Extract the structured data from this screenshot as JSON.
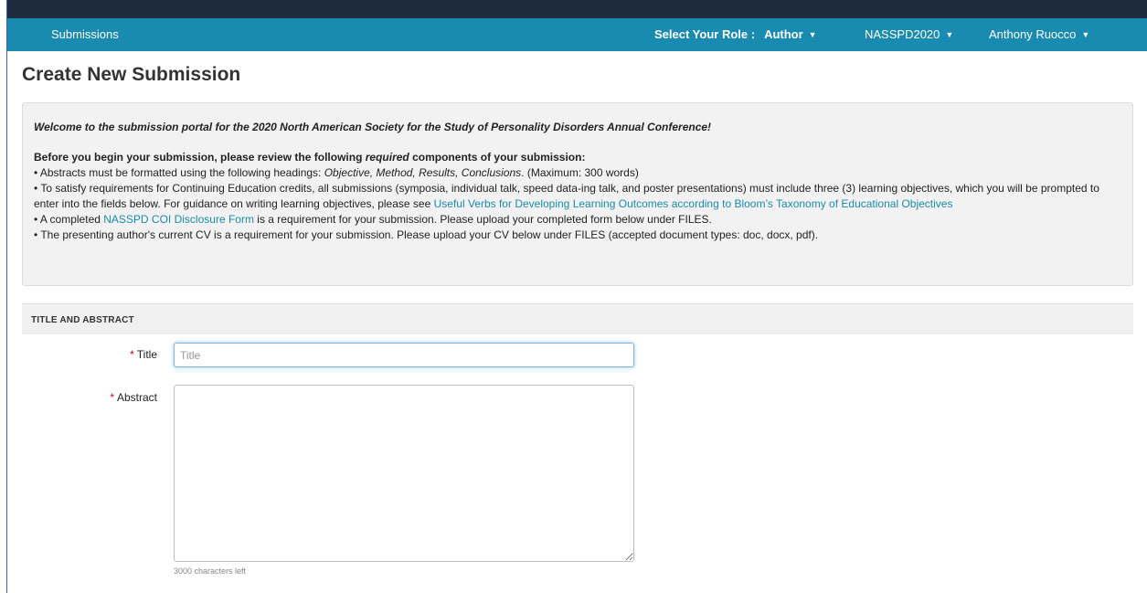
{
  "navbar": {
    "submissions": "Submissions",
    "role_label": "Select Your Role :",
    "role_value": "Author",
    "event": "NASSPD2020",
    "user": "Anthony Ruocco"
  },
  "page": {
    "title": "Create New Submission"
  },
  "info": {
    "welcome": "Welcome to the submission portal for the 2020 North American Society for the Study of Personality Disorders Annual Conference!",
    "req_head_before": "Before you begin your submission, please review the following ",
    "req_head_emph": "required",
    "req_head_after": " components of your submission:",
    "item1_before": "• Abstracts must be formatted using the following headings: ",
    "item1_emph": "Objective, Method, Results, Conclusions",
    "item1_after": ". (Maximum: 300 words)",
    "item2_text": "• To satisfy requirements for Continuing Education credits, all submissions (symposia, individual talk, speed data-ing talk, and poster presentations) must include three (3) learning objectives, which you will be prompted to enter into the fields below. For guidance on writing learning objectives, please see ",
    "item2_link": "Useful Verbs for Developing Learning Outcomes according to Bloom’s Taxonomy of Educational Objectives",
    "item3_before": "• A completed ",
    "item3_link": "NASSPD COI Disclosure Form",
    "item3_after": " is a requirement for your submission. Please upload your completed form below under FILES.",
    "item4_text": "• The presenting author's current CV is a requirement for your submission. Please upload your CV below under FILES (accepted document types: doc, docx, pdf)."
  },
  "section": {
    "title": "TITLE AND ABSTRACT"
  },
  "form": {
    "required_mark": "*",
    "title_label": "Title",
    "title_placeholder": "Title",
    "title_value": "",
    "abstract_label": "Abstract",
    "abstract_value": "",
    "chars_left": "3000 characters left"
  },
  "colors": {
    "navbar": "#1a8bb0",
    "topbar": "#1e2b3c",
    "link": "#1a8bb0",
    "required": "#d0021b"
  }
}
